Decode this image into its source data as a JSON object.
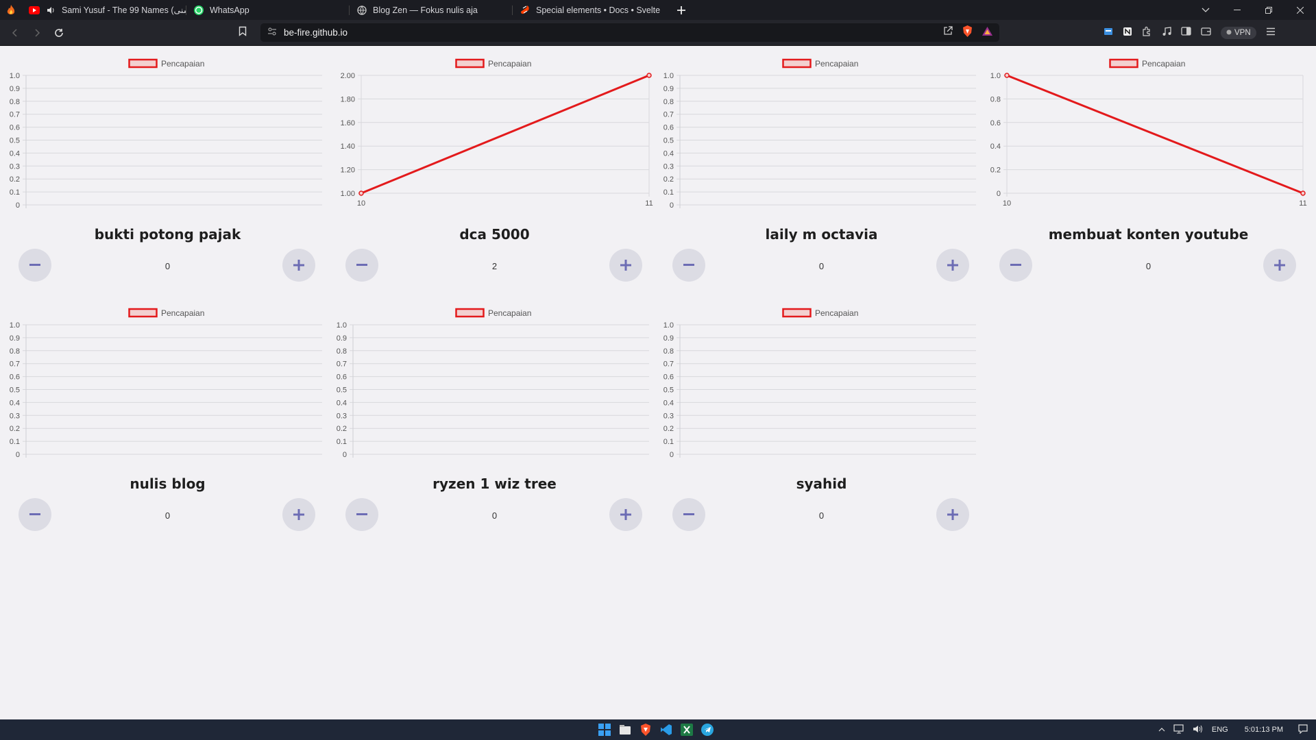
{
  "browser": {
    "tabs": [
      {
        "title": "Sami Yusuf - The 99 Names (حسنى",
        "icon": "youtube-icon"
      },
      {
        "title": "WhatsApp",
        "icon": "whatsapp-icon"
      },
      {
        "title": "Blog Zen — Fokus nulis aja",
        "icon": "globe-icon"
      },
      {
        "title": "Special elements • Docs • Svelte",
        "icon": "svelte-icon"
      }
    ],
    "url": "be-fire.github.io",
    "vpn_label": "VPN"
  },
  "cards": [
    {
      "name": "bukti potong pajak",
      "count": "0",
      "legend": "Pencapaian"
    },
    {
      "name": "dca 5000",
      "count": "2",
      "legend": "Pencapaian"
    },
    {
      "name": "laily m octavia",
      "count": "0",
      "legend": "Pencapaian"
    },
    {
      "name": "membuat konten youtube",
      "count": "0",
      "legend": "Pencapaian"
    },
    {
      "name": "nulis blog",
      "count": "0",
      "legend": "Pencapaian"
    },
    {
      "name": "ryzen 1 wiz tree",
      "count": "0",
      "legend": "Pencapaian"
    },
    {
      "name": "syahid",
      "count": "0",
      "legend": "Pencapaian"
    }
  ],
  "chart_data": [
    {
      "type": "line",
      "legend": [
        "Pencapaian"
      ],
      "x": [],
      "series": [
        {
          "name": "Pencapaian",
          "values": []
        }
      ],
      "ylim": [
        0,
        1
      ],
      "yticks": [
        "0",
        "0.1",
        "0.2",
        "0.3",
        "0.4",
        "0.5",
        "0.6",
        "0.7",
        "0.8",
        "0.9",
        "1.0"
      ],
      "xticks": []
    },
    {
      "type": "line",
      "legend": [
        "Pencapaian"
      ],
      "x": [
        10,
        11
      ],
      "series": [
        {
          "name": "Pencapaian",
          "values": [
            1,
            2
          ]
        }
      ],
      "ylim": [
        1,
        2
      ],
      "yticks": [
        "1.00",
        "1.20",
        "1.40",
        "1.60",
        "1.80",
        "2.00"
      ],
      "xticks": [
        "10",
        "11"
      ]
    },
    {
      "type": "line",
      "legend": [
        "Pencapaian"
      ],
      "x": [],
      "series": [
        {
          "name": "Pencapaian",
          "values": []
        }
      ],
      "ylim": [
        0,
        1
      ],
      "yticks": [
        "0",
        "0.1",
        "0.2",
        "0.3",
        "0.4",
        "0.5",
        "0.6",
        "0.7",
        "0.8",
        "0.9",
        "1.0"
      ],
      "xticks": []
    },
    {
      "type": "line",
      "legend": [
        "Pencapaian"
      ],
      "x": [
        10,
        11
      ],
      "series": [
        {
          "name": "Pencapaian",
          "values": [
            1,
            0
          ]
        }
      ],
      "ylim": [
        0,
        1
      ],
      "yticks": [
        "0",
        "0.2",
        "0.4",
        "0.6",
        "0.8",
        "1.0"
      ],
      "xticks": [
        "10",
        "11"
      ]
    },
    {
      "type": "line",
      "legend": [
        "Pencapaian"
      ],
      "x": [],
      "series": [
        {
          "name": "Pencapaian",
          "values": []
        }
      ],
      "ylim": [
        0,
        1
      ],
      "yticks": [
        "0",
        "0.1",
        "0.2",
        "0.3",
        "0.4",
        "0.5",
        "0.6",
        "0.7",
        "0.8",
        "0.9",
        "1.0"
      ],
      "xticks": []
    },
    {
      "type": "line",
      "legend": [
        "Pencapaian"
      ],
      "x": [],
      "series": [
        {
          "name": "Pencapaian",
          "values": []
        }
      ],
      "ylim": [
        0,
        1
      ],
      "yticks": [
        "0",
        "0.1",
        "0.2",
        "0.3",
        "0.4",
        "0.5",
        "0.6",
        "0.7",
        "0.8",
        "0.9",
        "1.0"
      ],
      "xticks": []
    },
    {
      "type": "line",
      "legend": [
        "Pencapaian"
      ],
      "x": [],
      "series": [
        {
          "name": "Pencapaian",
          "values": []
        }
      ],
      "ylim": [
        0,
        1
      ],
      "yticks": [
        "0",
        "0.1",
        "0.2",
        "0.3",
        "0.4",
        "0.5",
        "0.6",
        "0.7",
        "0.8",
        "0.9",
        "1.0"
      ],
      "xticks": []
    }
  ],
  "colors": {
    "series": "#e31a1c",
    "legend_fill": "#f3d0d0",
    "fab": "#17c5ea"
  },
  "taskbar": {
    "language": "ENG",
    "time": "5:01:13 PM"
  }
}
